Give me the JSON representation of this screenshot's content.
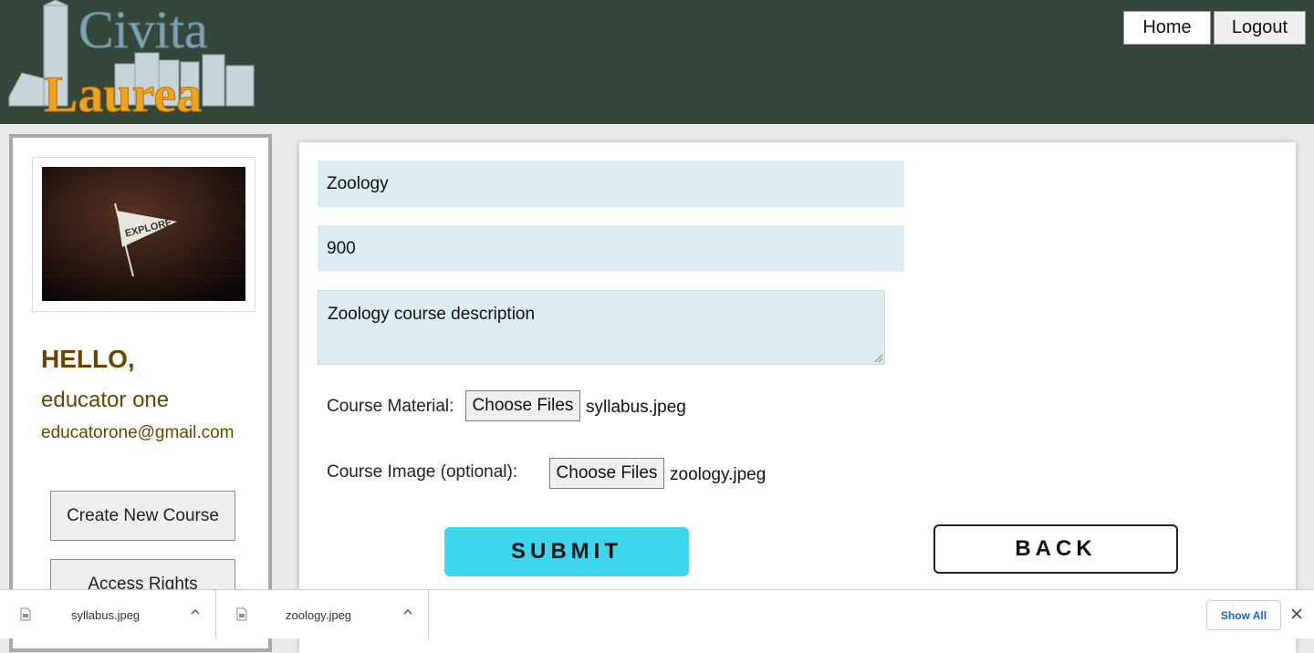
{
  "header": {
    "logo_text_top": "Civita",
    "logo_text_bottom": "Laurea",
    "home_label": "Home",
    "logout_label": "Logout",
    "background": "#34473a"
  },
  "sidebar": {
    "profile_image_text": "EXPLORE",
    "greeting": "HELLO,",
    "user_name": "educator one",
    "user_email": "educatorone@gmail.com",
    "create_course_label": "Create New Course",
    "access_rights_label": "Access Rights"
  },
  "form": {
    "title_value": "Zoology",
    "price_value": "900",
    "description_value": "Zoology course description",
    "material_label": "Course Material:",
    "material_button": "Choose Files",
    "material_file": "syllabus.jpeg",
    "image_label": "Course Image (optional):",
    "image_button": "Choose Files",
    "image_file": "zoology.jpeg",
    "submit_label": "SUBMIT",
    "back_label": "BACK",
    "field_bg": "#dcecf0",
    "submit_color": "#3dd6ec"
  },
  "downloads": {
    "items": [
      {
        "name": "syllabus.jpeg",
        "icon": "file-image-icon"
      },
      {
        "name": "zoology.jpeg",
        "icon": "file-image-icon"
      }
    ],
    "show_all_label": "Show All"
  }
}
